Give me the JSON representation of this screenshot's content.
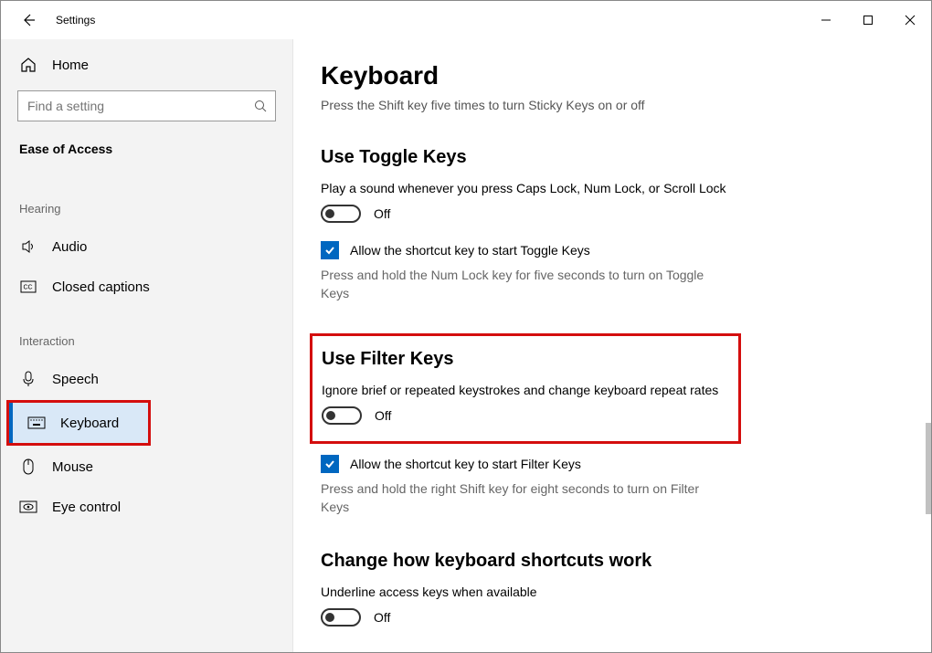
{
  "window": {
    "title": "Settings"
  },
  "sidebar": {
    "home": "Home",
    "searchPlaceholder": "Find a setting",
    "currentSection": "Ease of Access",
    "groups": [
      {
        "label": "Hearing",
        "items": [
          {
            "id": "audio",
            "label": "Audio",
            "icon": "audio"
          },
          {
            "id": "closed-captions",
            "label": "Closed captions",
            "icon": "cc"
          }
        ]
      },
      {
        "label": "Interaction",
        "items": [
          {
            "id": "speech",
            "label": "Speech",
            "icon": "mic"
          },
          {
            "id": "keyboard",
            "label": "Keyboard",
            "icon": "keyboard",
            "active": true
          },
          {
            "id": "mouse",
            "label": "Mouse",
            "icon": "mouse"
          },
          {
            "id": "eye-control",
            "label": "Eye control",
            "icon": "eye"
          }
        ]
      }
    ]
  },
  "page": {
    "title": "Keyboard",
    "subtitle": "Press the Shift key five times to turn Sticky Keys on or off",
    "s1": {
      "heading": "Use Toggle Keys",
      "desc": "Play a sound whenever you press Caps Lock, Num Lock, or Scroll Lock",
      "toggleState": "Off",
      "checkboxLabel": "Allow the shortcut key to start Toggle Keys",
      "hint": "Press and hold the Num Lock key for five seconds to turn on Toggle Keys"
    },
    "s2": {
      "heading": "Use Filter Keys",
      "desc": "Ignore brief or repeated keystrokes and change keyboard repeat rates",
      "toggleState": "Off",
      "checkboxLabel": "Allow the shortcut key to start Filter Keys",
      "hint": "Press and hold the right Shift key for eight seconds to turn on Filter Keys"
    },
    "s3": {
      "heading": "Change how keyboard shortcuts work",
      "desc": "Underline access keys when available",
      "toggleState": "Off"
    }
  }
}
